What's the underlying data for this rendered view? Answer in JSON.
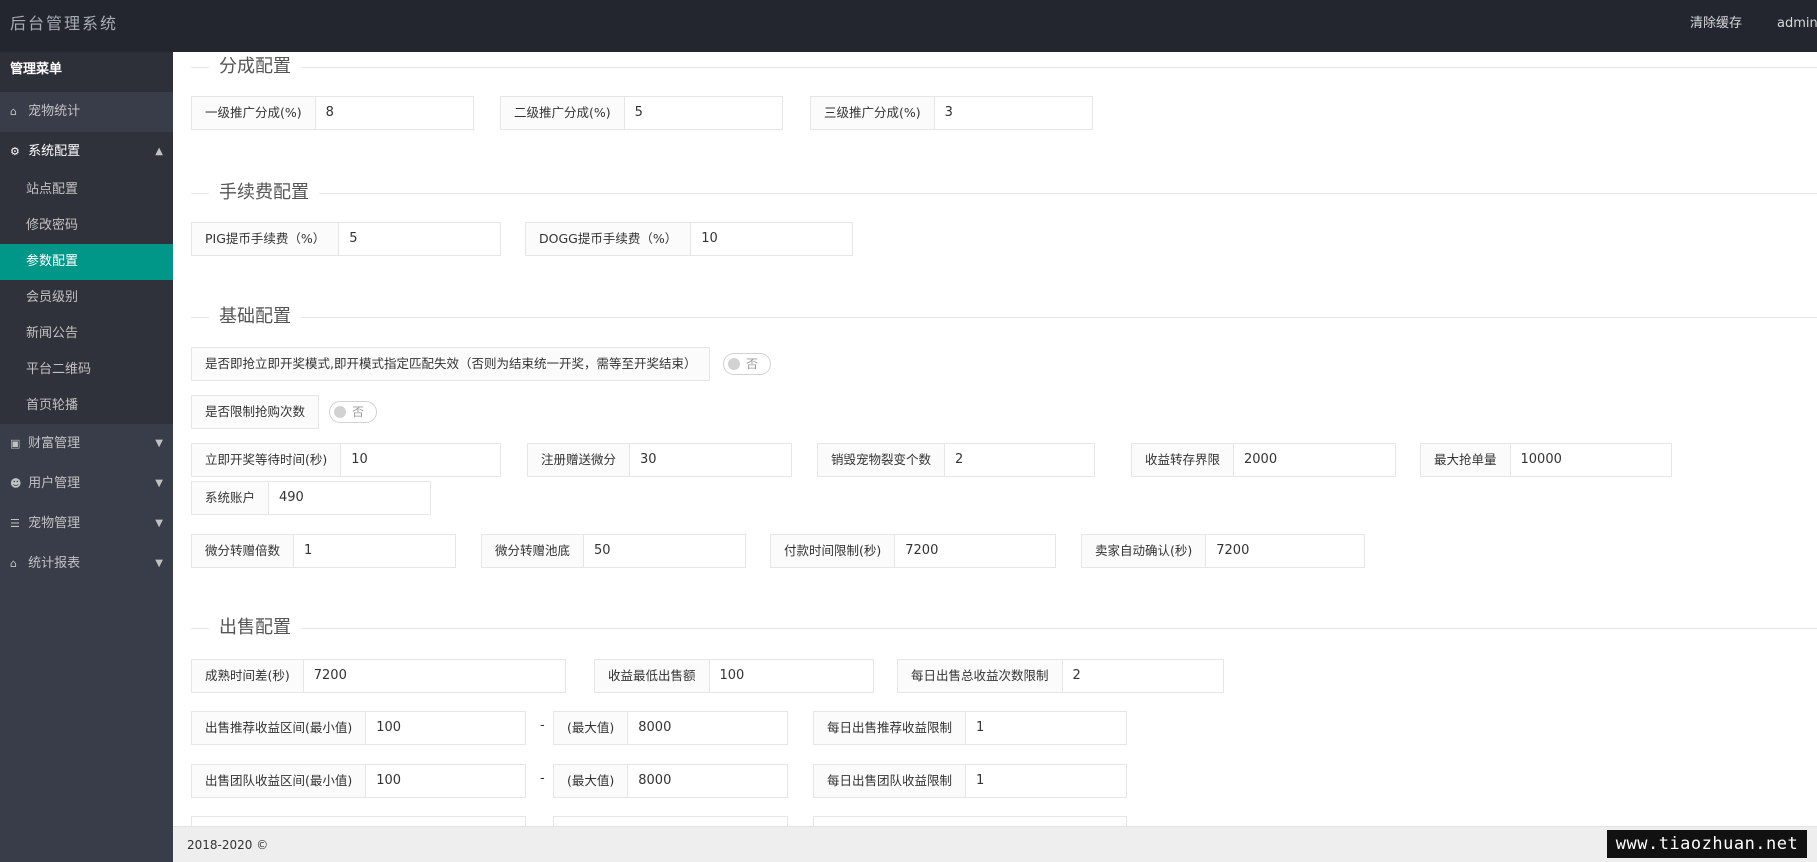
{
  "header": {
    "title": "后台管理系统",
    "clear_cache": "清除缓存",
    "user": "admin"
  },
  "sidebar": {
    "title": "管理菜单",
    "items": [
      {
        "label": "宠物统计",
        "icon": "home-icon"
      },
      {
        "label": "系统配置",
        "icon": "gears-icon",
        "open": true,
        "children": [
          "站点配置",
          "修改密码",
          "参数配置",
          "会员级别",
          "新闻公告",
          "平台二维码",
          "首页轮播"
        ],
        "active_child": "参数配置"
      },
      {
        "label": "财富管理",
        "icon": "money-icon"
      },
      {
        "label": "用户管理",
        "icon": "users-icon"
      },
      {
        "label": "宠物管理",
        "icon": "list-icon"
      },
      {
        "label": "统计报表",
        "icon": "home-icon"
      }
    ]
  },
  "sections": {
    "commission": "分成配置",
    "fee": "手续费配置",
    "basic": "基础配置",
    "sale": "出售配置"
  },
  "commission": {
    "level1_label": "一级推广分成(%)",
    "level1_value": "8",
    "level2_label": "二级推广分成(%)",
    "level2_value": "5",
    "level3_label": "三级推广分成(%)",
    "level3_value": "3"
  },
  "fee": {
    "pig_label": "PIG提币手续费（%）",
    "pig_value": "5",
    "dogg_label": "DOGG提币手续费（%）",
    "dogg_value": "10"
  },
  "basic": {
    "instant_mode_label": "是否即抢立即开奖模式,即开模式指定匹配失效（否则为结束统一开奖，需等至开奖结束）",
    "instant_mode_switch": "否",
    "limit_label": "是否限制抢购次数",
    "limit_switch": "否",
    "wait_label": "立即开奖等待时间(秒)",
    "wait_value": "10",
    "reg_label": "注册赠送微分",
    "reg_value": "30",
    "destroy_label": "销毁宠物裂变个数",
    "destroy_value": "2",
    "income_label": "收益转存界限",
    "income_value": "2000",
    "max_label": "最大抢单量",
    "max_value": "10000",
    "account_label": "系统账户",
    "account_value": "490",
    "multi_label": "微分转赠倍数",
    "multi_value": "1",
    "pool_label": "微分转赠池底",
    "pool_value": "50",
    "pay_label": "付款时间限制(秒)",
    "pay_value": "7200",
    "confirm_label": "卖家自动确认(秒)",
    "confirm_value": "7200"
  },
  "sale": {
    "mature_label": "成熟时间差(秒)",
    "mature_value": "7200",
    "min_sale_label": "收益最低出售额",
    "min_sale_value": "100",
    "daily_total_label": "每日出售总收益次数限制",
    "daily_total_value": "2",
    "rec_min_label": "出售推荐收益区间(最小值)",
    "rec_min_value": "100",
    "dash": "-",
    "rec_max_label": "(最大值)",
    "rec_max_value": "8000",
    "rec_daily_label": "每日出售推荐收益限制",
    "rec_daily_value": "1",
    "team_min_label": "出售团队收益区间(最小值)",
    "team_min_value": "100",
    "team_max_label": "(最大值)",
    "team_max_value": "8000",
    "team_daily_label": "每日出售团队收益限制",
    "team_daily_value": "1"
  },
  "footer": {
    "copyright": "2018-2020 ©"
  },
  "watermark": "www.tiaozhuan.net"
}
